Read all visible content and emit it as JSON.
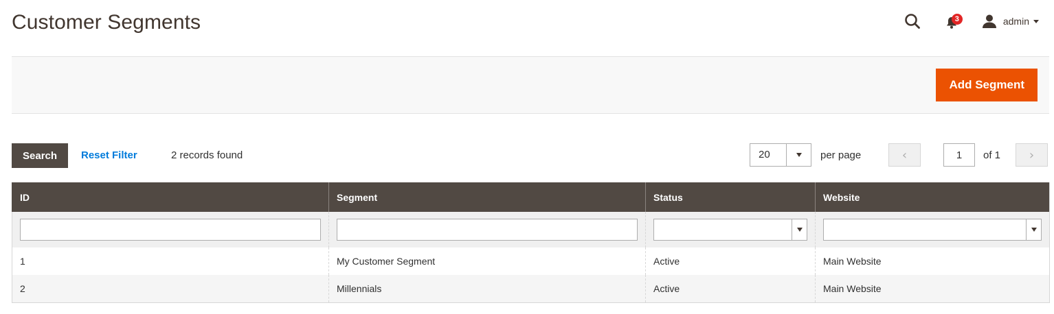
{
  "page": {
    "title": "Customer Segments"
  },
  "header": {
    "notifications_count": "3",
    "user_name": "admin",
    "icons": {
      "search": "search-icon",
      "notifications": "bell-icon",
      "user": "user-icon"
    }
  },
  "actions": {
    "add_segment_label": "Add Segment"
  },
  "toolbar": {
    "search_label": "Search",
    "reset_label": "Reset Filter",
    "records_text": "2 records found",
    "per_page_value": "20",
    "per_page_label": "per page",
    "current_page": "1",
    "page_of": "of 1"
  },
  "grid": {
    "columns": [
      "ID",
      "Segment",
      "Status",
      "Website"
    ],
    "rows": [
      {
        "id": "1",
        "segment": "My Customer Segment",
        "status": "Active",
        "website": "Main Website"
      },
      {
        "id": "2",
        "segment": "Millennials",
        "status": "Active",
        "website": "Main Website"
      }
    ]
  },
  "colors": {
    "accent": "#eb5202",
    "header_dark": "#514943",
    "link": "#007bdb",
    "badge": "#e22626"
  }
}
